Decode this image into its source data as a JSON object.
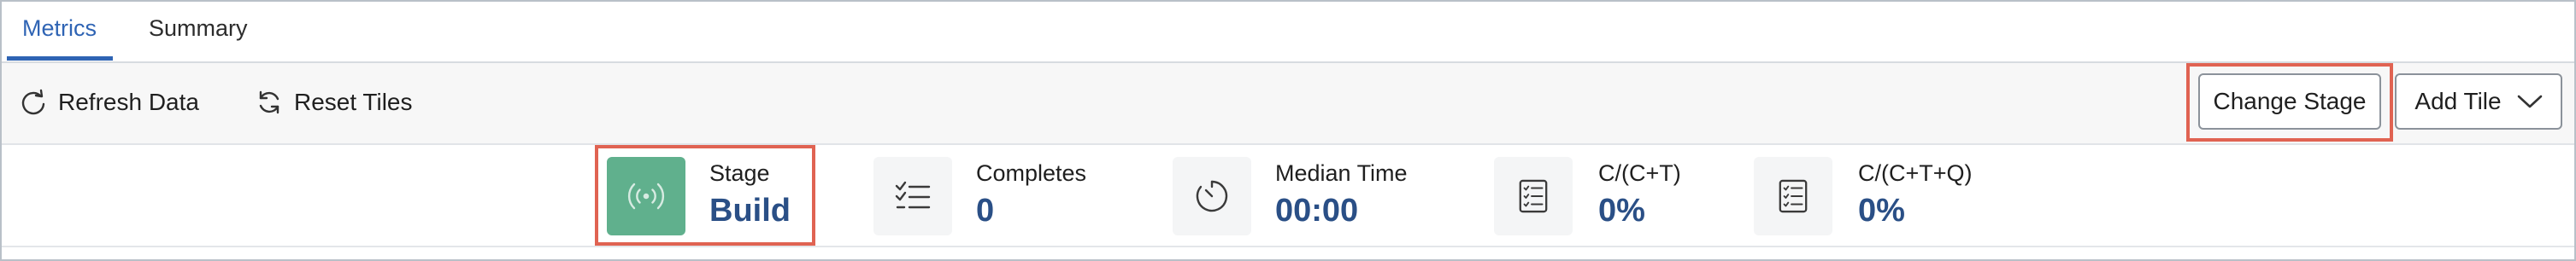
{
  "tabs": [
    {
      "label": "Metrics",
      "active": true
    },
    {
      "label": "Summary",
      "active": false
    }
  ],
  "toolbar": {
    "refresh_label": "Refresh Data",
    "reset_label": "Reset Tiles",
    "change_stage_label": "Change Stage",
    "add_tile_label": "Add Tile"
  },
  "tiles": [
    {
      "label": "Stage",
      "value": "Build",
      "icon": "broadcast-icon"
    },
    {
      "label": "Completes",
      "value": "0",
      "icon": "checklist-icon"
    },
    {
      "label": "Median Time",
      "value": "00:00",
      "icon": "timer-icon"
    },
    {
      "label": "C/(C+T)",
      "value": "0%",
      "icon": "report-list-icon"
    },
    {
      "label": "C/(C+T+Q)",
      "value": "0%",
      "icon": "report-list-icon"
    }
  ],
  "colors": {
    "accent": "#2f64b4",
    "value_text": "#2a4f86",
    "stage_tile": "#60b08d",
    "highlight": "#e06352"
  }
}
